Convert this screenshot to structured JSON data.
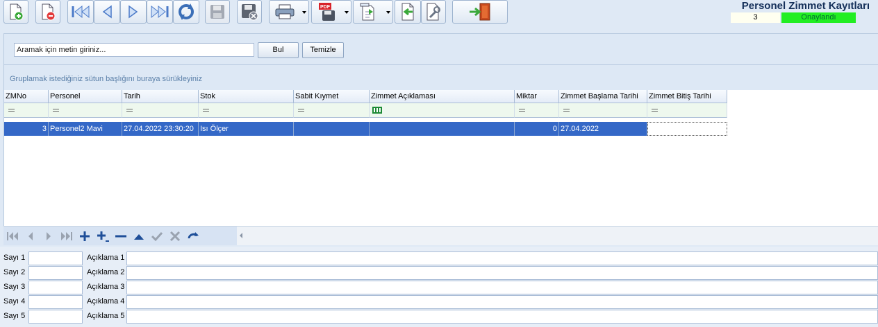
{
  "header": {
    "title": "Personel Zimmet Kayıtları",
    "record_number": "3",
    "status": "Onaylandı",
    "status_color": "#22ee22"
  },
  "toolbar": {
    "buttons": [
      "new-document-icon",
      "delete-document-icon",
      "first-record-icon",
      "previous-record-icon",
      "next-record-icon",
      "last-record-icon",
      "refresh-icon",
      "save-disabled-icon",
      "cancel-save-icon",
      "print-icon",
      "pdf-export-icon",
      "export-icon",
      "import-icon",
      "settings-icon",
      "exit-icon"
    ]
  },
  "search": {
    "placeholder": "Aramak için metin giriniz...",
    "find_label": "Bul",
    "clear_label": "Temizle"
  },
  "group_panel": {
    "hint": "Gruplamak istediğiniz sütun başlığını buraya sürükleyiniz"
  },
  "grid": {
    "columns": [
      "ZMNo",
      "Personel",
      "Tarih",
      "Stok",
      "Sabit Kıymet",
      "Zimmet Açıklaması",
      "Miktar",
      "Zimmet Başlama Tarihi",
      "Zimmet Bitiş Tarihi"
    ],
    "rows": [
      [
        "3",
        "Personel2 Mavi",
        "27.04.2022 23:30:20",
        "Isı Ölçer",
        "",
        "",
        "0",
        "27.04.2022",
        ""
      ]
    ],
    "selection_color": "#3468c7"
  },
  "bottom_form": {
    "rows": [
      {
        "number_label": "Sayı 1",
        "number_value": "",
        "desc_label": "Açıklama 1",
        "desc_value": ""
      },
      {
        "number_label": "Sayı 2",
        "number_value": "",
        "desc_label": "Açıklama 2",
        "desc_value": ""
      },
      {
        "number_label": "Sayı 3",
        "number_value": "",
        "desc_label": "Açıklama 3",
        "desc_value": ""
      },
      {
        "number_label": "Sayı 4",
        "number_value": "",
        "desc_label": "Açıklama 4",
        "desc_value": ""
      },
      {
        "number_label": "Sayı 5",
        "number_value": "",
        "desc_label": "Açıklama 5",
        "desc_value": ""
      }
    ]
  }
}
